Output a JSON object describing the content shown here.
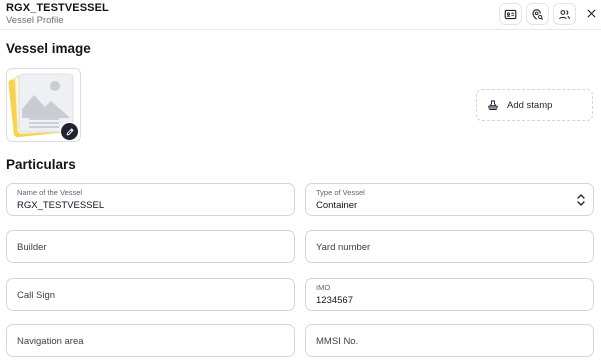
{
  "header": {
    "title": "RGX_TESTVESSEL",
    "subtitle": "Vessel Profile",
    "icons": [
      "id-card-icon",
      "location-search-icon",
      "users-icon",
      "close-icon"
    ]
  },
  "vessel_image": {
    "title": "Vessel image",
    "add_stamp_label": "Add stamp"
  },
  "particulars": {
    "title": "Particulars",
    "fields": {
      "name": {
        "label": "Name of the Vessel",
        "value": "RGX_TESTVESSEL"
      },
      "type": {
        "label": "Type of Vessel",
        "value": "Container"
      },
      "builder": {
        "placeholder": "Builder"
      },
      "yard_number": {
        "placeholder": "Yard number"
      },
      "call_sign": {
        "placeholder": "Call Sign"
      },
      "imo": {
        "label": "IMO",
        "value": "1234567"
      },
      "navigation_area": {
        "placeholder": "Navigation area"
      },
      "mmsi": {
        "placeholder": "MMSI No."
      }
    }
  },
  "colors": {
    "border": "#d4d7de",
    "text": "#12141c",
    "placeholder_accent": "#f5c842",
    "badge": "#1f2230"
  }
}
